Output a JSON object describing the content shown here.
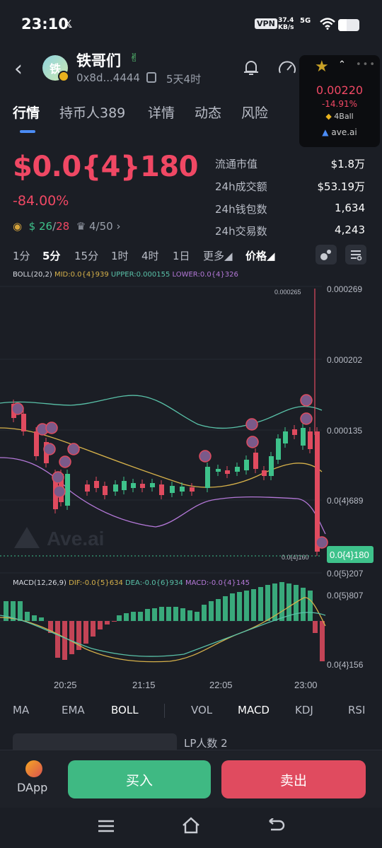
{
  "status": {
    "time": "23:10",
    "x_icon": "x-logo-icon",
    "vpn": "VPN",
    "speed_value": "37.4",
    "speed_unit": "KB/s",
    "network": "5G"
  },
  "header": {
    "avatar_text": "铁",
    "token_name": "铁哥们",
    "token_emoji": "✌",
    "address": "0x8d...4444",
    "age": "5天4时"
  },
  "popup": {
    "price": "0.00220",
    "change": "-14.91%",
    "pair": "4Ball",
    "brand": "ave.ai"
  },
  "tabs": [
    {
      "label": "行情"
    },
    {
      "label": "持币人389"
    },
    {
      "label": "详情"
    },
    {
      "label": "动态"
    },
    {
      "label": "风险"
    }
  ],
  "price": {
    "big": "$0.0{4}180",
    "change": "-84.00%",
    "badge_count_a": "26",
    "badge_count_b": "28",
    "badge_rank": "4/50"
  },
  "stats": [
    {
      "label": "流通市值",
      "value": "$1.8万"
    },
    {
      "label": "24h成交额",
      "value": "$53.19万"
    },
    {
      "label": "24h钱包数",
      "value": "1,634"
    },
    {
      "label": "24h交易数",
      "value": "4,243"
    }
  ],
  "intervals": [
    "1分",
    "5分",
    "15分",
    "1时",
    "4时",
    "1日",
    "更多◢",
    "价格◢"
  ],
  "boll_legend": {
    "name": "BOLL(20,2)",
    "mid": "MID:0.0{4}939",
    "upper": "UPPER:0.000155",
    "lower": "LOWER:0.0{4}326"
  },
  "macd_legend": {
    "name": "MACD(12,26,9)",
    "dif": "DIF:-0.0{5}634",
    "dea": "DEA:-0.0{6}934",
    "macd": "MACD:-0.0{4}145"
  },
  "chart_data": {
    "type": "candlestick",
    "watermark": "Ave.ai",
    "y_ticks": [
      "0.000269",
      "0.000202",
      "0.000135",
      "0.0{4}689",
      "0.0{5}207"
    ],
    "current_price": "0.0{4}180",
    "high_label": "0.000265",
    "low_label": "0.0{4}160",
    "macd_ticks": [
      "0.0{5}807",
      "0.0{4}156"
    ],
    "x_ticks": [
      "20:25",
      "21:15",
      "22:05",
      "23:00"
    ],
    "colors": {
      "up": "#3ec28b",
      "down": "#e04b5f",
      "mid": "#d6b14a",
      "upper": "#59c1a8",
      "lower": "#b478d8"
    }
  },
  "indicator_tabs": [
    "MA",
    "EMA",
    "BOLL",
    "VOL",
    "MACD",
    "KDJ",
    "RSI"
  ],
  "peek_text": "LP人数  2",
  "actions": {
    "dapp": "DApp",
    "buy": "买入",
    "sell": "卖出"
  }
}
